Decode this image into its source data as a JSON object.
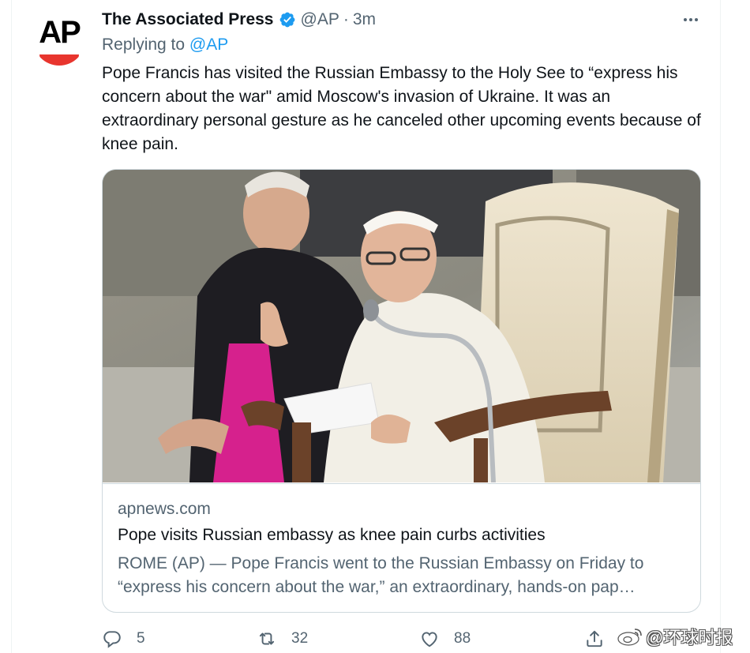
{
  "tweet": {
    "author_name": "The Associated Press",
    "handle": "@AP",
    "separator": "·",
    "time": "3m",
    "avatar_text": "AP",
    "replying_prefix": "Replying to",
    "replying_to": "@AP",
    "text": "Pope Francis has visited the Russian Embassy to the Holy See to “express his concern about the war\" amid Moscow's invasion of Ukraine. It was an extraordinary personal gesture as he canceled other upcoming events because of knee pain."
  },
  "card": {
    "image_icon": "photo-pope-francis",
    "domain": "apnews.com",
    "title": "Pope visits Russian embassy as knee pain curbs activities",
    "description": "ROME (AP) — Pope Francis went to the Russian Embassy on Friday to “express his concern about the war,” an extraordinary, hands-on pap…"
  },
  "actions": {
    "reply_icon": "reply-icon",
    "reply_count": "5",
    "retweet_icon": "retweet-icon",
    "retweet_count": "32",
    "like_icon": "heart-icon",
    "like_count": "88",
    "share_icon": "share-icon"
  },
  "watermark": {
    "text": "@环球时报",
    "icon": "weibo-icon"
  },
  "colors": {
    "accent": "#1d9bf0",
    "text": "#0f1419",
    "secondary": "#536471",
    "border": "#cfd9de",
    "ap_red": "#e8352e"
  }
}
